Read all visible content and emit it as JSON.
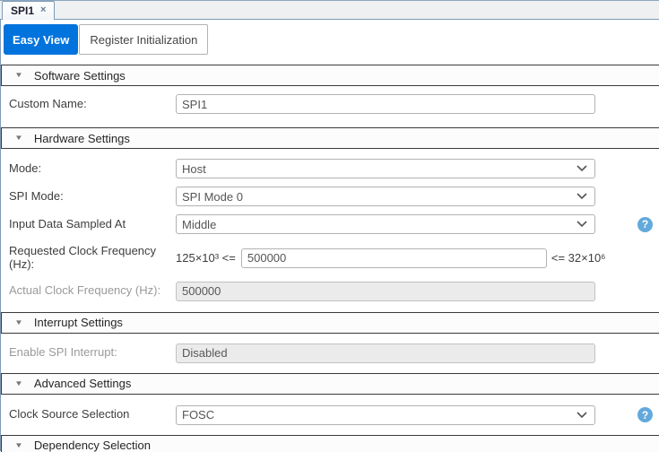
{
  "window": {
    "tab_title": "SPI1",
    "close_glyph": "×"
  },
  "view_tabs": {
    "easy_view": "Easy View",
    "register_initialization": "Register Initialization"
  },
  "icons": {
    "collapse_triangle": "▼",
    "help_glyph": "?"
  },
  "colors": {
    "accent_blue": "#0173dd",
    "help_blue": "#63a9db",
    "tab_border_blue": "#7e9cb8"
  },
  "sections": {
    "software": {
      "title": "Software Settings"
    },
    "hardware": {
      "title": "Hardware Settings"
    },
    "interrupt": {
      "title": "Interrupt Settings"
    },
    "advanced": {
      "title": "Advanced Settings"
    },
    "dependency": {
      "title": "Dependency Selection"
    }
  },
  "fields": {
    "custom_name": {
      "label": "Custom Name:",
      "value": "SPI1"
    },
    "mode": {
      "label": "Mode:",
      "value": "Host"
    },
    "spi_mode": {
      "label": "SPI Mode:",
      "value": "SPI Mode 0"
    },
    "input_data_sampled_at": {
      "label": "Input Data Sampled At",
      "value": "Middle"
    },
    "requested_clock_frequency": {
      "label": "Requested Clock Frequency (Hz):",
      "min_text": "125×10³ <=",
      "value": "500000",
      "max_text": "<= 32×10⁶"
    },
    "actual_clock_frequency": {
      "label": "Actual Clock Frequency (Hz):",
      "value": "500000"
    },
    "enable_spi_interrupt": {
      "label": "Enable SPI Interrupt:",
      "value": "Disabled"
    },
    "clock_source_selection": {
      "label": "Clock Source Selection",
      "value": "FOSC"
    }
  }
}
